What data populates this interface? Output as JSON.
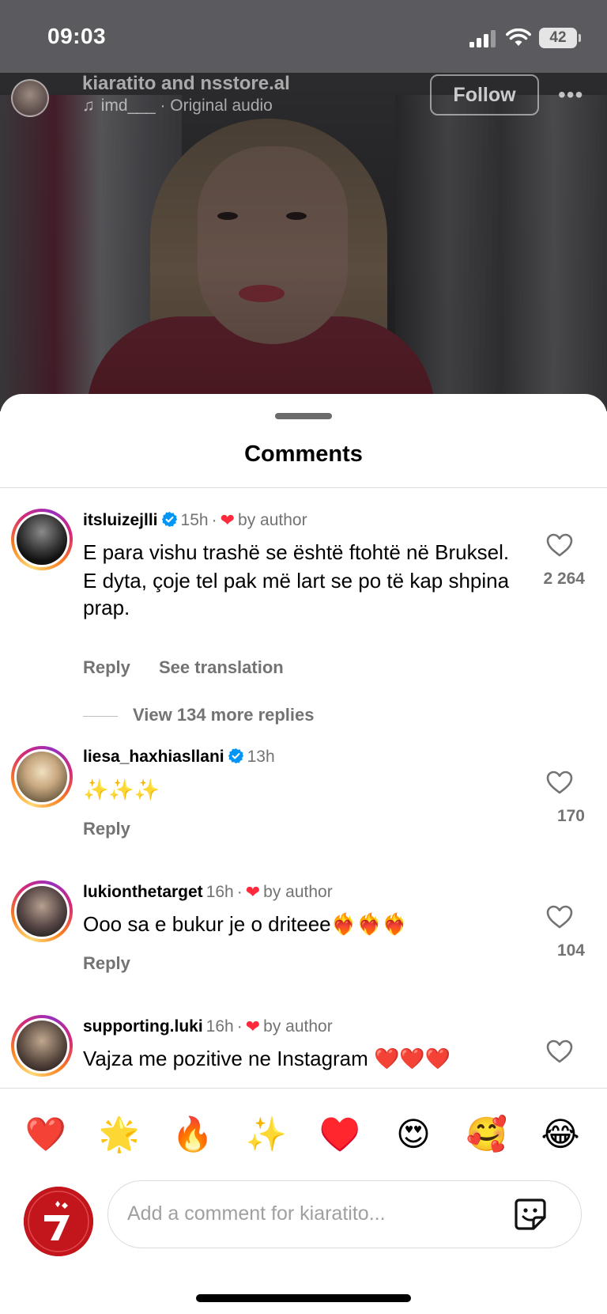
{
  "status_bar": {
    "time": "09:03",
    "battery": "42"
  },
  "reel": {
    "authors": "kiaratito and nsstore.al",
    "audio": "imd___ · Original audio",
    "follow_label": "Follow",
    "more_label": "•••"
  },
  "sheet": {
    "title": "Comments"
  },
  "comments": [
    {
      "username": "itsluizejlli",
      "verified": true,
      "time": "15h",
      "liked_by_author": true,
      "by_author_label": "by author",
      "text_lines": [
        "E para vishu trashë se është ftohtë në Bruksel.",
        "E dyta, çoje tel pak më lart se po të kap shpina prap."
      ],
      "reply_label": "Reply",
      "translate_label": "See translation",
      "likes": "2 264",
      "more_replies": "View 134 more replies"
    },
    {
      "username": "liesa_haxhiasllani",
      "verified": true,
      "time": "13h",
      "liked_by_author": false,
      "text": "✨✨✨",
      "reply_label": "Reply",
      "likes": "170"
    },
    {
      "username": "lukionthetarget",
      "verified": false,
      "time": "16h",
      "liked_by_author": true,
      "by_author_label": "by author",
      "text": "Ooo sa e bukur je o driteee❤️‍🔥❤️‍🔥❤️‍🔥",
      "reply_label": "Reply",
      "likes": "104"
    },
    {
      "username": "supporting.luki",
      "verified": false,
      "time": "16h",
      "liked_by_author": true,
      "by_author_label": "by author",
      "text": "Vajza me pozitive ne Instagram ❤️❤️❤️"
    }
  ],
  "quick_reactions": [
    "❤️",
    "🌟",
    "🔥",
    "✨",
    "♥️",
    "😍",
    "🥰",
    "😂"
  ],
  "composer": {
    "placeholder": "Add a comment for kiaratito..."
  },
  "colors": {
    "accent_red": "#ff2b3d",
    "verified_blue": "#0095f6",
    "muted": "#737373"
  }
}
